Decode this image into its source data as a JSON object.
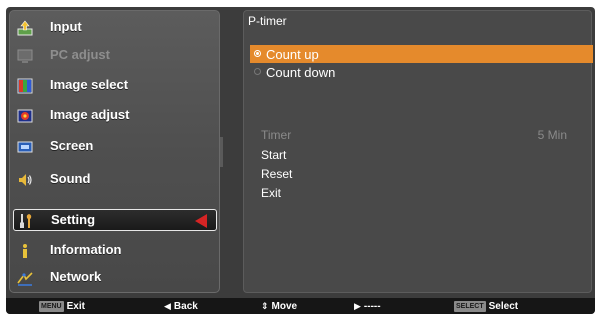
{
  "menu": {
    "items": [
      {
        "label": "Input",
        "icon": "input-icon",
        "state": "normal"
      },
      {
        "label": "PC adjust",
        "icon": "pc-adjust-icon",
        "state": "disabled"
      },
      {
        "label": "Image select",
        "icon": "image-select-icon",
        "state": "normal"
      },
      {
        "label": "Image adjust",
        "icon": "image-adjust-icon",
        "state": "normal"
      },
      {
        "label": "Screen",
        "icon": "screen-icon",
        "state": "normal"
      },
      {
        "label": "Sound",
        "icon": "sound-icon",
        "state": "normal"
      },
      {
        "label": "Setting",
        "icon": "setting-icon",
        "state": "selected"
      },
      {
        "label": "Information",
        "icon": "information-icon",
        "state": "normal"
      },
      {
        "label": "Network",
        "icon": "network-icon",
        "state": "normal"
      }
    ]
  },
  "submenu": {
    "title": "P-timer",
    "options": [
      {
        "label": "Count up",
        "selected": true
      },
      {
        "label": "Count down",
        "selected": false
      }
    ],
    "timer": {
      "label": "Timer",
      "value": "5 Min"
    },
    "actions": [
      "Start",
      "Reset",
      "Exit"
    ]
  },
  "help_bar": {
    "exit": {
      "key": "MENU",
      "label": "Exit"
    },
    "back": {
      "glyph": "◀",
      "label": "Back"
    },
    "move": {
      "glyph": "⇕",
      "label": "Move"
    },
    "next": {
      "glyph": "▶",
      "label": "-----"
    },
    "select": {
      "key": "SELECT",
      "label": "Select"
    }
  },
  "colors": {
    "highlight": "#e58a2c",
    "selection_arrow": "#d62424",
    "panel": "#494949",
    "disabled_text": "#8a8a8a"
  }
}
